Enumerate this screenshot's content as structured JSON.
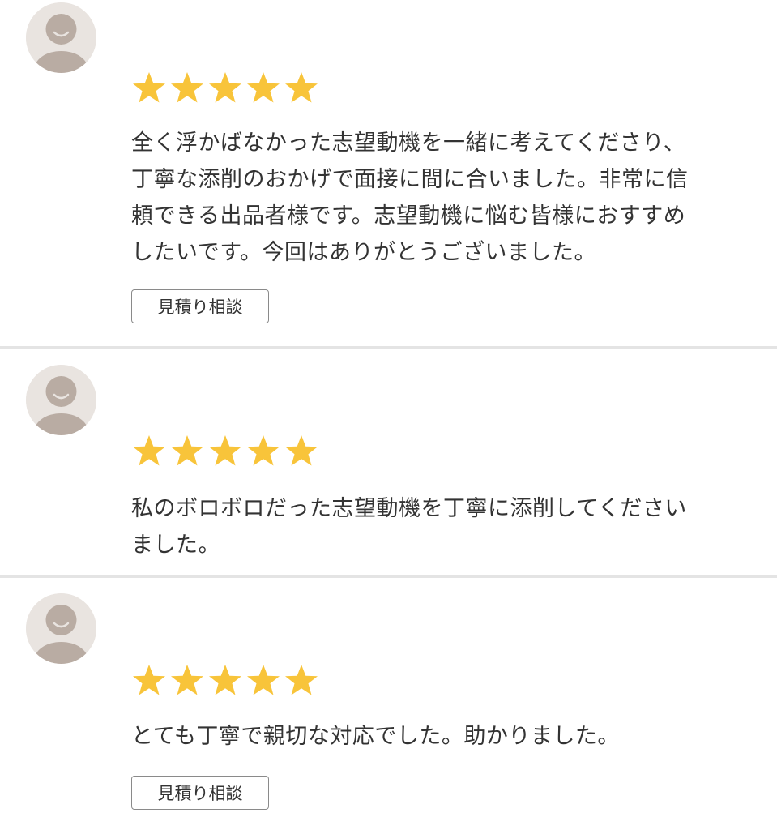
{
  "reviews": [
    {
      "avatar_icon": "default-user-icon",
      "rating": 5,
      "comment": "全く浮かばなかった志望動機を一緒に考えてくださり、\n丁寧な添削のおかげで面接に間に合いました。非常に信\n頼できる出品者様です。志望動機に悩む皆様におすすめ\nしたいです。今回はありがとうございました。",
      "button_label": "見積り相談"
    },
    {
      "avatar_icon": "default-user-icon",
      "rating": 5,
      "comment": "私のボロボロだった志望動機を丁寧に添削してください\nました。"
    },
    {
      "avatar_icon": "default-user-icon",
      "rating": 5,
      "comment": "とても丁寧で親切な対応でした。助かりました。",
      "button_label": "見積り相談"
    }
  ],
  "colors": {
    "star": "#f8c43a",
    "avatar_bg": "#e9e4e0",
    "avatar_figure": "#b9aca3",
    "text": "#333333",
    "divider": "#e4e4e4"
  }
}
